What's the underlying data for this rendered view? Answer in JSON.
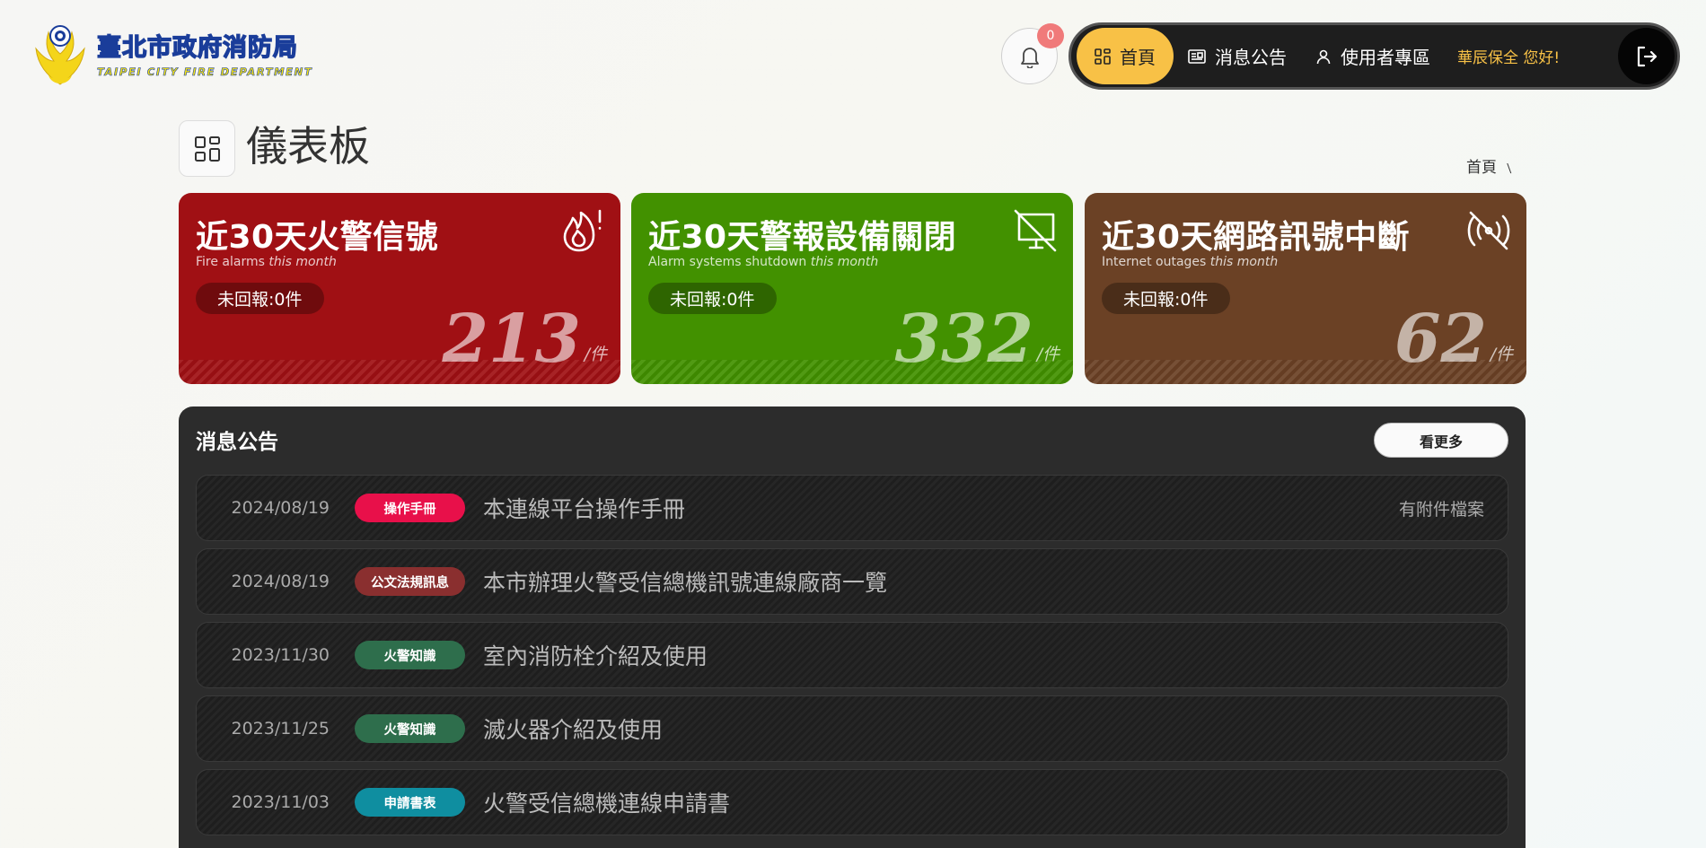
{
  "header": {
    "logo_zh": "臺北市政府消防局",
    "logo_en": "TAIPEI CITY FIRE DEPARTMENT",
    "notification_count": "0",
    "nav": [
      {
        "label": "首頁",
        "icon": "dashboard-icon",
        "active": true
      },
      {
        "label": "消息公告",
        "icon": "news-icon",
        "active": false
      },
      {
        "label": "使用者專區",
        "icon": "user-icon",
        "active": false
      }
    ],
    "greeting": "華辰保全 您好!"
  },
  "page": {
    "title": "儀表板",
    "breadcrumb": "首頁 ﹨"
  },
  "cards": [
    {
      "title": "近30天火警信號",
      "sub_en": "Fire alarms",
      "sub_em": "this month",
      "pill": "未回報:0件",
      "value": "213",
      "unit": "/件",
      "icon": "fire-alert-icon",
      "color": "#a01014"
    },
    {
      "title": "近30天警報設備關閉",
      "sub_en": "Alarm systems shutdown",
      "sub_em": "this month",
      "pill": "未回報:0件",
      "value": "332",
      "unit": "/件",
      "icon": "monitor-off-icon",
      "color": "#429100"
    },
    {
      "title": "近30天網路訊號中斷",
      "sub_en": "Internet outages",
      "sub_em": "this month",
      "pill": "未回報:0件",
      "value": "62",
      "unit": "/件",
      "icon": "signal-off-icon",
      "color": "#6b4125"
    }
  ],
  "news": {
    "title": "消息公告",
    "more_label": "看更多",
    "rows": [
      {
        "date": "2024/08/19",
        "tag": "操作手冊",
        "tag_color": "#e8104a",
        "text": "本連線平台操作手冊",
        "attachment": "有附件檔案"
      },
      {
        "date": "2024/08/19",
        "tag": "公文法規訊息",
        "tag_color": "#8a2f2f",
        "text": "本市辦理火警受信總機訊號連線廠商一覽",
        "attachment": ""
      },
      {
        "date": "2023/11/30",
        "tag": "火警知識",
        "tag_color": "#2e6e4c",
        "text": "室內消防栓介紹及使用",
        "attachment": ""
      },
      {
        "date": "2023/11/25",
        "tag": "火警知識",
        "tag_color": "#2e6e4c",
        "text": "滅火器介紹及使用",
        "attachment": ""
      },
      {
        "date": "2023/11/03",
        "tag": "申請書表",
        "tag_color": "#0f8ea0",
        "text": "火警受信總機連線申請書",
        "attachment": ""
      }
    ]
  }
}
